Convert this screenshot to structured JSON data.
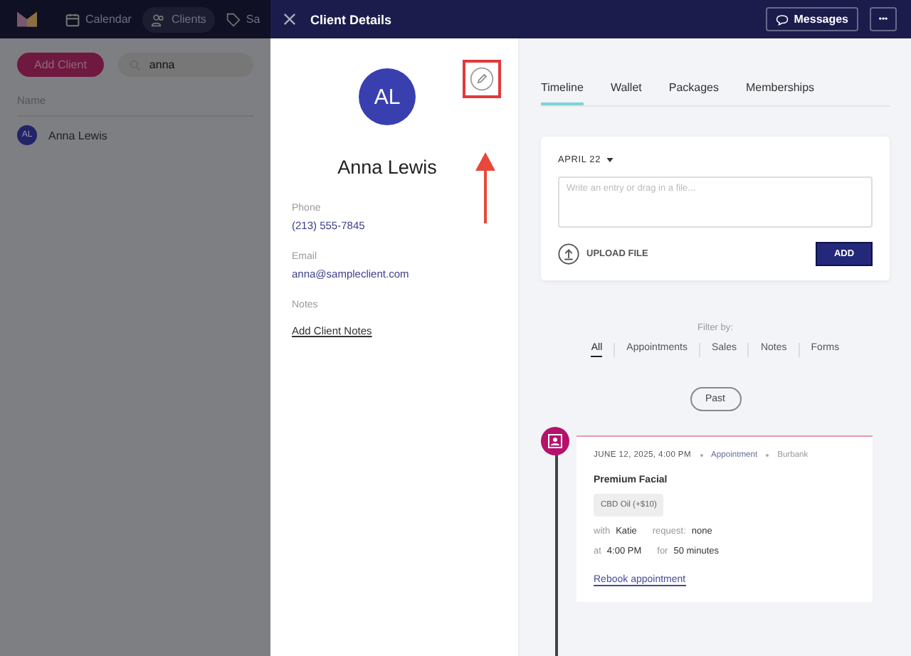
{
  "app": {
    "nav": [
      {
        "label": "Calendar",
        "selected": false
      },
      {
        "label": "Clients",
        "selected": true
      },
      {
        "label": "Sa",
        "selected": false
      }
    ],
    "add_button": "Add Client",
    "search": {
      "value": "anna"
    },
    "table": {
      "columns": [
        "Name"
      ],
      "rows": [
        {
          "initials": "AL",
          "name": "Anna Lewis"
        }
      ]
    }
  },
  "drawer": {
    "title": "Client Details",
    "messages_button": "Messages",
    "more_button": "•••",
    "client": {
      "initials": "AL",
      "name": "Anna Lewis",
      "fields": [
        {
          "label": "Phone",
          "value": "(213) 555-7845",
          "kind": "text"
        },
        {
          "label": "Email",
          "value": "anna@sampleclient.com",
          "kind": "text"
        },
        {
          "label": "Notes",
          "value": "Add Client Notes",
          "kind": "link"
        }
      ]
    },
    "tabs": [
      {
        "label": "Timeline",
        "selected": true
      },
      {
        "label": "Wallet",
        "selected": false
      },
      {
        "label": "Packages",
        "selected": false
      },
      {
        "label": "Memberships",
        "selected": false
      }
    ],
    "entry": {
      "date": "APRIL 22",
      "placeholder": "Write an entry or drag in a file...",
      "upload": "UPLOAD FILE",
      "add": "ADD"
    },
    "filter_label": "Filter by:",
    "filters": [
      {
        "label": "All",
        "selected": true
      },
      {
        "label": "Appointments",
        "selected": false
      },
      {
        "label": "Sales",
        "selected": false
      },
      {
        "label": "Notes",
        "selected": false
      },
      {
        "label": "Forms",
        "selected": false
      }
    ],
    "past_button": "Past",
    "appointment": {
      "date": "JUNE 12, 2025, 4:00 PM",
      "type": "Appointment",
      "location": "Burbank",
      "service": "Premium Facial",
      "addon": "CBD Oil (+$10)",
      "with_label": "with",
      "staff": "Katie",
      "request_label": "request:",
      "request": "none",
      "at_label": "at",
      "time": "4:00 PM",
      "for_label": "for",
      "duration": "50 minutes",
      "rebook": "Rebook appointment"
    }
  }
}
